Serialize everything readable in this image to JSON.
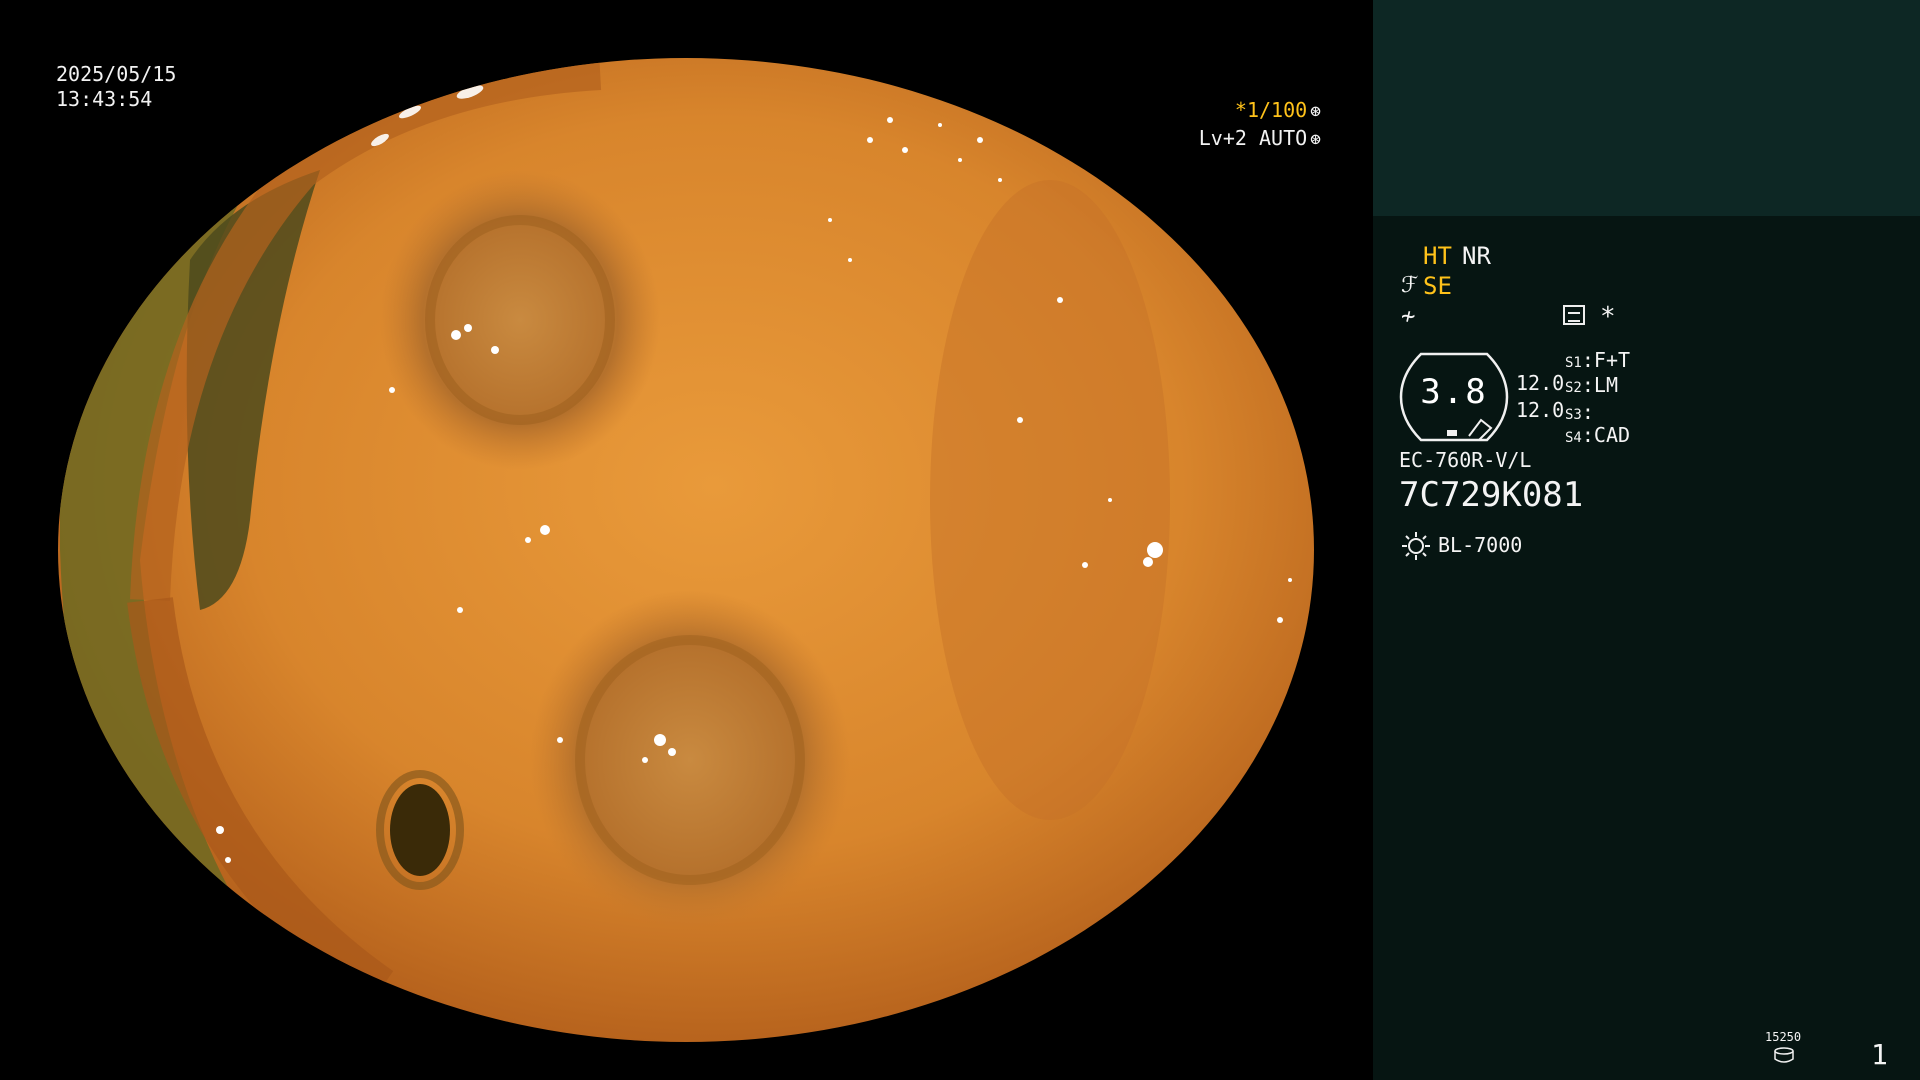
{
  "osd": {
    "date": "2025/05/15",
    "time": "13:43:54",
    "shutter_prefix": "*1/100",
    "level": "Lv+2",
    "mode": "AUTO"
  },
  "panel": {
    "ht": "HT",
    "nr": "NR",
    "se": "SE",
    "asterisk": "*",
    "gauge_value": "3.8",
    "gauge_val_1": "12.0",
    "gauge_val_2": "12.0",
    "s1": {
      "label": "S1",
      "value": "F+T"
    },
    "s2": {
      "label": "S2",
      "value": "LM"
    },
    "s3": {
      "label": "S3",
      "value": ""
    },
    "s4": {
      "label": "S4",
      "value": "CAD"
    },
    "scope_model": "EC-760R-V/L",
    "scope_serial": "7C729K081",
    "light_source": "BL-7000",
    "drive_label": "15250",
    "page_number": "1"
  },
  "colors": {
    "accent_yellow": "#ffc21a",
    "panel_bg": "#061512",
    "panel_top_bg": "#0d2724",
    "tissue_orange": "#d8852c"
  },
  "icons": [
    "shutter-icon",
    "auto-icon",
    "structure-enhance-icon",
    "slash-icon",
    "pattern-icon",
    "light-icon",
    "drive-icon"
  ]
}
